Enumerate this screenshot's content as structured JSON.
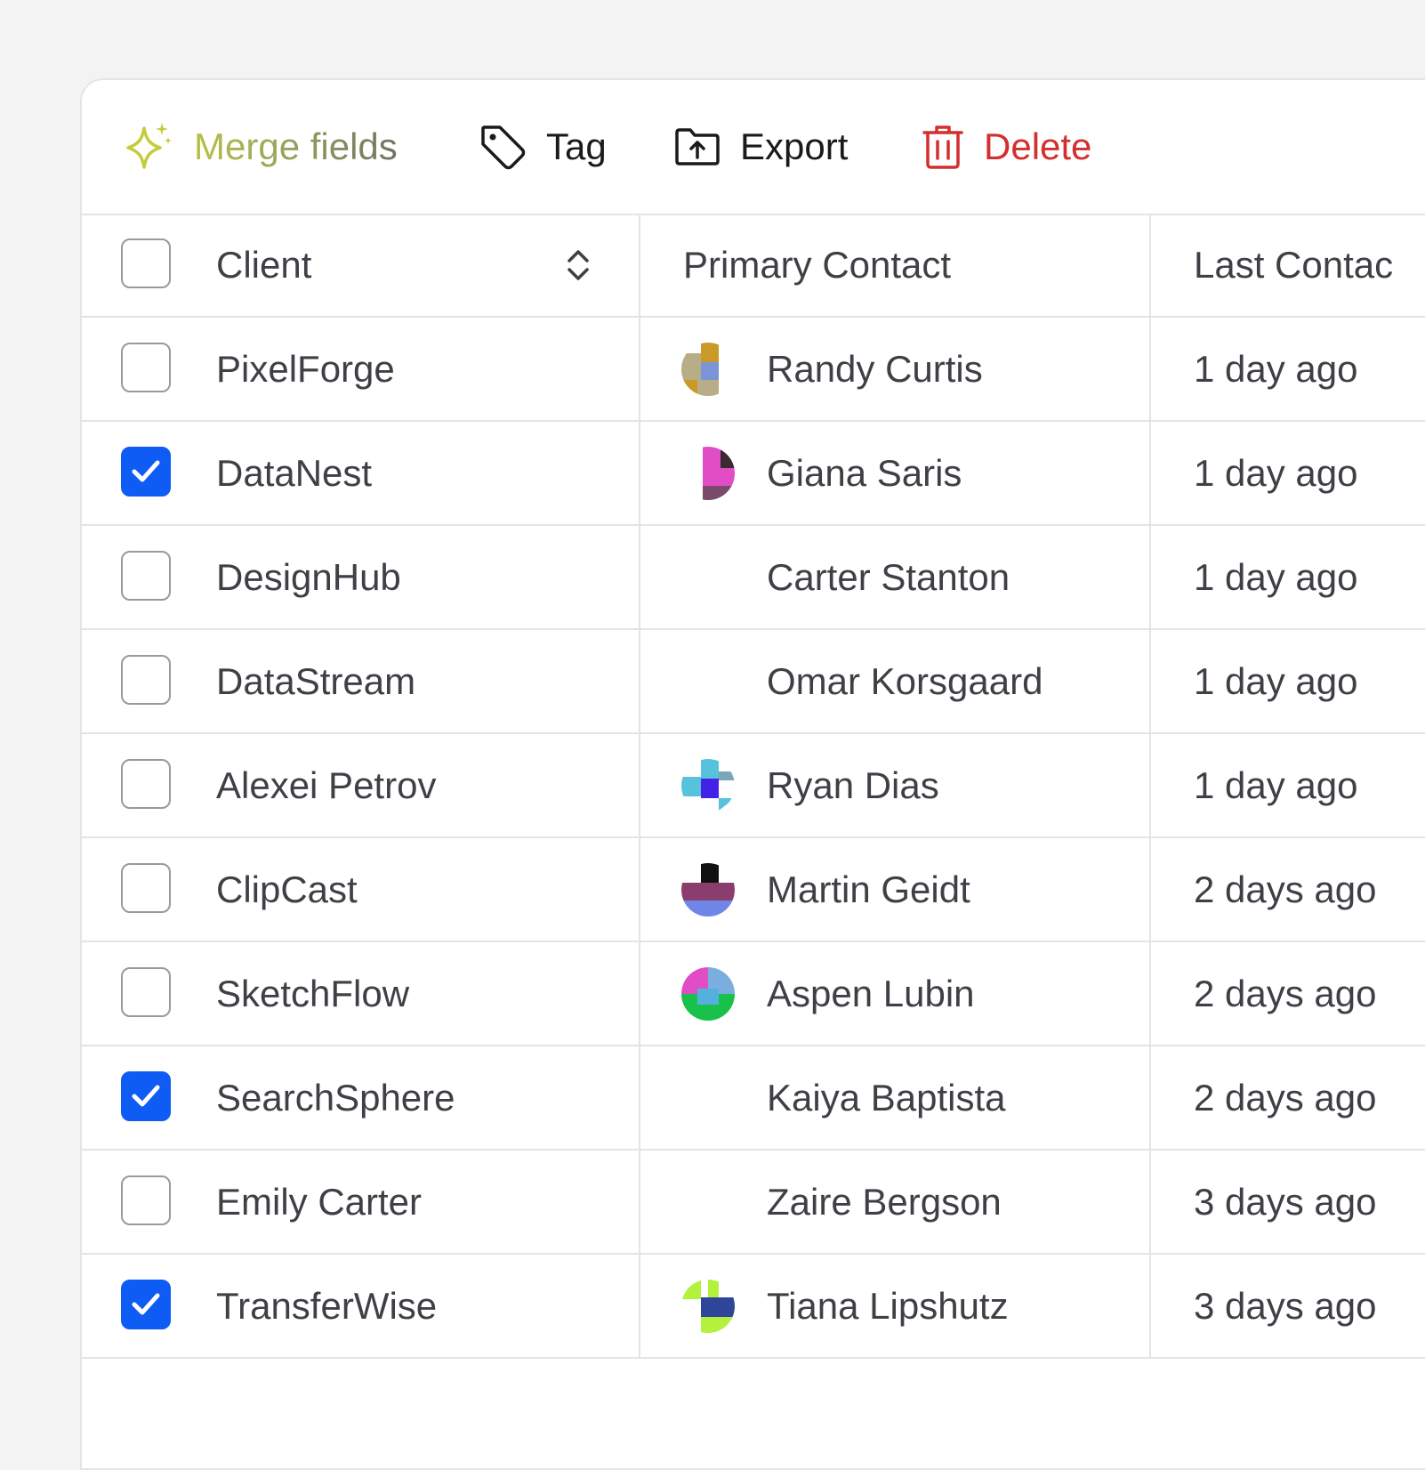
{
  "toolbar": {
    "merge_label": "Merge fields",
    "merge_icon": "sparkles-icon",
    "tag_label": "Tag",
    "tag_icon": "tag-icon",
    "export_label": "Export",
    "export_icon": "folder-upload-icon",
    "delete_label": "Delete",
    "delete_icon": "trash-icon",
    "delete_color": "#d32f2f"
  },
  "table": {
    "headers": {
      "client": "Client",
      "primary_contact": "Primary Contact",
      "last_contacted": "Last Contac"
    },
    "header_checked": false,
    "accent_color": "#0f5cf5",
    "rows": [
      {
        "client": "PixelForge",
        "contact": "Randy Curtis",
        "last": "1 day ago",
        "checked": false,
        "avatar": "pixel"
      },
      {
        "client": "DataNest",
        "contact": "Giana Saris",
        "last": "1 day ago",
        "checked": true,
        "avatar": "pink"
      },
      {
        "client": "DesignHub",
        "contact": "Carter Stanton",
        "last": "1 day ago",
        "checked": false,
        "avatar": "none"
      },
      {
        "client": "DataStream",
        "contact": "Omar Korsgaard",
        "last": "1 day ago",
        "checked": false,
        "avatar": "none"
      },
      {
        "client": "Alexei Petrov",
        "contact": "Ryan Dias",
        "last": "1 day ago",
        "checked": false,
        "avatar": "blue"
      },
      {
        "client": "ClipCast",
        "contact": "Martin Geidt",
        "last": "2 days ago",
        "checked": false,
        "avatar": "stripes"
      },
      {
        "client": "SketchFlow",
        "contact": "Aspen Lubin",
        "last": "2 days ago",
        "checked": false,
        "avatar": "quad"
      },
      {
        "client": "SearchSphere",
        "contact": "Kaiya Baptista",
        "last": "2 days ago",
        "checked": true,
        "avatar": "none"
      },
      {
        "client": "Emily Carter",
        "contact": "Zaire Bergson",
        "last": "3 days ago",
        "checked": false,
        "avatar": "none"
      },
      {
        "client": "TransferWise",
        "contact": "Tiana Lipshutz",
        "last": "3 days ago",
        "checked": true,
        "avatar": "lime"
      }
    ]
  }
}
